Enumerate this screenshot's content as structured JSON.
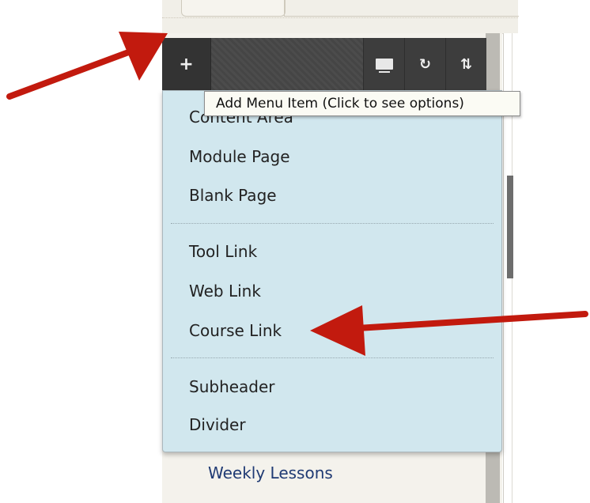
{
  "toolbar": {
    "add_symbol": "+",
    "refresh_symbol": "↻",
    "sort_symbol": "⇅"
  },
  "tooltip": {
    "text": "Add Menu Item (Click to see options)"
  },
  "menu": {
    "items": [
      {
        "label": "Content Area"
      },
      {
        "label": "Module Page"
      },
      {
        "label": "Blank Page"
      },
      {
        "label": "Tool Link"
      },
      {
        "label": "Web Link"
      },
      {
        "label": "Course Link"
      },
      {
        "label": "Subheader"
      },
      {
        "label": "Divider"
      }
    ]
  },
  "course_menu": {
    "visible_link": "Weekly Lessons"
  },
  "colors": {
    "menu_background": "#d1e7ee",
    "toolbar_background": "#4a4a4a",
    "arrow": "#c21a0e",
    "link": "#1f3a73"
  }
}
